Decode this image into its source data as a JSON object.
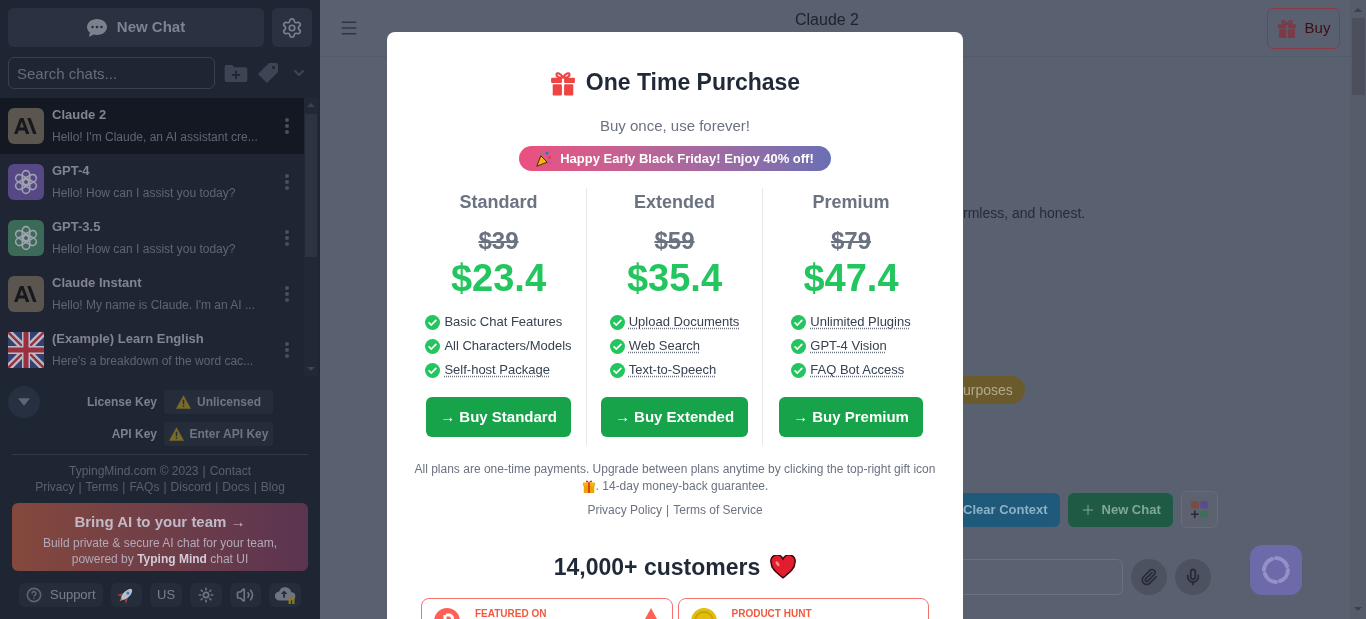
{
  "sidebar": {
    "new_chat_button": "New Chat",
    "search": {
      "placeholder": "Search chats..."
    },
    "chats": [
      {
        "title": "Claude 2",
        "preview": "Hello! I'm Claude, an AI assistant cre...",
        "kind": "anthropic",
        "color": "#5b5550",
        "selected": true
      },
      {
        "title": "GPT-4",
        "preview": "Hello! How can I assist you today?",
        "kind": "openai",
        "color": "#564785",
        "selected": false
      },
      {
        "title": "GPT-3.5",
        "preview": "Hello! How can I assist you today?",
        "kind": "openai",
        "color": "#3b6a58",
        "selected": false
      },
      {
        "title": "Claude Instant",
        "preview": "Hello! My name is Claude. I'm an AI ...",
        "kind": "anthropic",
        "color": "#5b5550",
        "selected": false
      },
      {
        "title": "(Example) Learn English",
        "preview": "Here's a breakdown of the word cac...",
        "kind": "flag",
        "selected": false
      }
    ],
    "keys": [
      {
        "label": "License Key",
        "value": "Unlicensed"
      },
      {
        "label": "API Key",
        "value": "Enter API Key"
      }
    ],
    "footer": [
      {
        "lead": "TypingMind.com © 2023",
        "links": [
          "Contact"
        ],
        "separators": [
          "|"
        ]
      },
      {
        "links": [
          "Privacy",
          "Terms",
          "FAQs",
          "Discord",
          "Docs",
          "Blog"
        ],
        "separators": [
          "|",
          "|",
          "|",
          "|",
          "|"
        ]
      }
    ],
    "team_promo": {
      "title": "Bring AI to your team →",
      "body": "Build private & secure AI chat for your team, powered by **Typing Mind** chat UI"
    },
    "toolbar": [
      {
        "kind": "support",
        "label": "Support"
      },
      {
        "kind": "rocket"
      },
      {
        "kind": "language",
        "label": "US"
      },
      {
        "kind": "theme"
      },
      {
        "kind": "sound"
      },
      {
        "kind": "sync"
      }
    ]
  },
  "main": {
    "header": {
      "title": "Claude 2",
      "buy_button": "Buy"
    },
    "message_fragment": "rmless, and honest.",
    "suggestion_fragment": "urposes",
    "actions": [
      {
        "kind": "clear_context",
        "label": "Clear Context"
      },
      {
        "kind": "new_chat",
        "label": "New Chat"
      },
      {
        "kind": "plugins"
      }
    ]
  },
  "modal": {
    "title": "One Time Purchase",
    "subtitle": "Buy once, use forever!",
    "promo": "Happy Early Black Friday! Enjoy 40% off!",
    "plans": [
      {
        "name": "Standard",
        "old_price": "$39",
        "price": "$23.4",
        "features": [
          {
            "text": "Basic Chat Features",
            "underlined": false
          },
          {
            "text": "All Characters/Models",
            "underlined": false
          },
          {
            "text": "Self-host Package",
            "underlined": true
          }
        ],
        "button": "→ Buy Standard"
      },
      {
        "name": "Extended",
        "old_price": "$59",
        "price": "$35.4",
        "features": [
          {
            "text": "Upload Documents",
            "underlined": true
          },
          {
            "text": "Web Search",
            "underlined": true
          },
          {
            "text": "Text-to-Speech",
            "underlined": true
          }
        ],
        "button": "→ Buy Extended"
      },
      {
        "name": "Premium",
        "old_price": "$79",
        "price": "$47.4",
        "features": [
          {
            "text": "Unlimited Plugins",
            "underlined": true
          },
          {
            "text": "GPT-4 Vision",
            "underlined": true
          },
          {
            "text": "FAQ Bot Access",
            "underlined": true
          }
        ],
        "button": "→ Buy Premium"
      }
    ],
    "note_before_icon": "All plans are one-time payments. Upgrade between plans anytime by clicking the top-right gift icon",
    "note_after_icon": ". 14-day money-back guarantee.",
    "links": [
      "Privacy Policy",
      "Terms of Service"
    ],
    "link_separators": [
      "|"
    ],
    "customers": "14,000+ customers",
    "badges": [
      {
        "kind": "featured",
        "label": "FEATURED ON"
      },
      {
        "kind": "product_hunt",
        "label": "PRODUCT HUNT"
      }
    ]
  }
}
